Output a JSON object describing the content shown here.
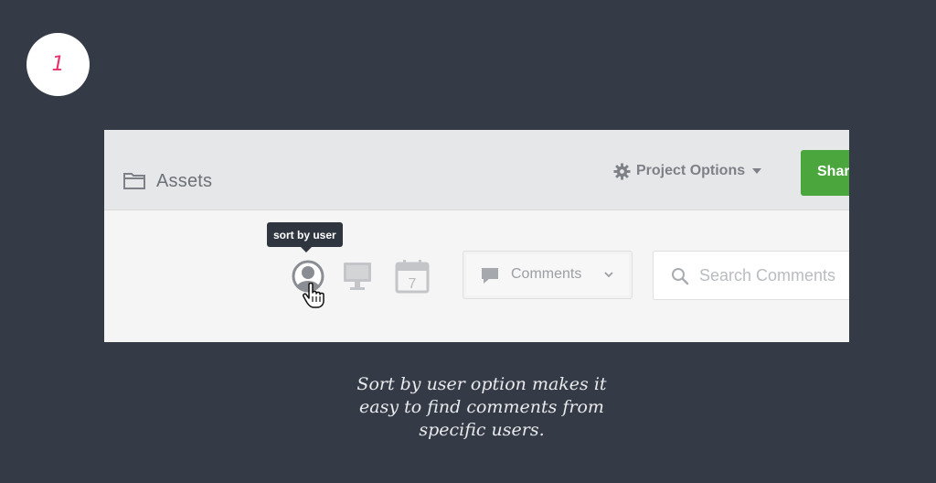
{
  "step": {
    "number": "1"
  },
  "app": {
    "section_title": "Assets",
    "project_options_label": "Project Options",
    "share_label": "Share"
  },
  "toolbar": {
    "tooltip": "sort by user",
    "comments_filter_label": "Comments",
    "search_placeholder": "Search Comments",
    "calendar_day": "7"
  },
  "caption": {
    "line1": "Sort by user option makes it",
    "line2": "easy to find comments from",
    "line3": "specific users."
  },
  "colors": {
    "background": "#343a46",
    "step_number": "#e8336a",
    "share_button": "#4aa63d",
    "tooltip_bg": "#303640"
  },
  "icons": [
    "folder-icon",
    "gear-icon",
    "caret-down-icon",
    "user-icon",
    "desktop-icon",
    "calendar-icon",
    "pointer-cursor-icon",
    "comment-bubble-icon",
    "chevron-down-icon",
    "search-icon"
  ]
}
